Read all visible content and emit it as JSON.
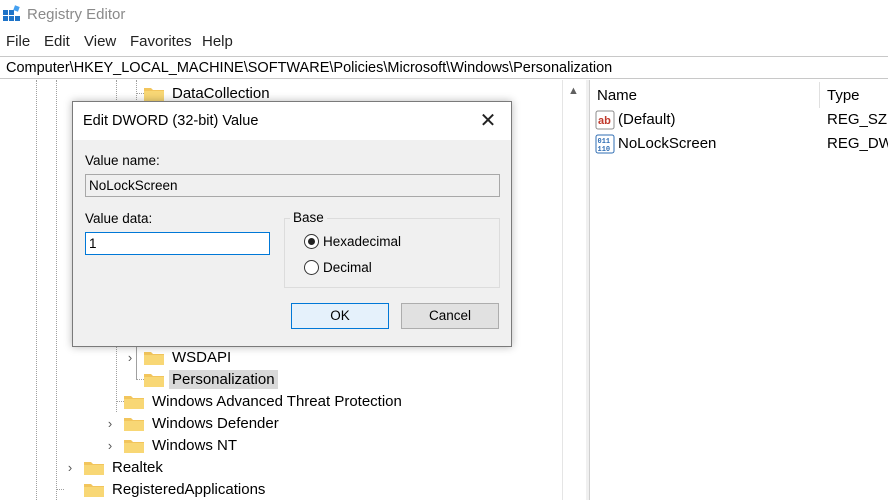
{
  "window": {
    "title": "Registry Editor",
    "icon": "registry-icon"
  },
  "menu": {
    "items": [
      "File",
      "Edit",
      "View",
      "Favorites",
      "Help"
    ]
  },
  "address": "Computer\\HKEY_LOCAL_MACHINE\\SOFTWARE\\Policies\\Microsoft\\Windows\\Personalization",
  "tree": {
    "items": [
      {
        "label": "DataCollection"
      },
      {
        "label": "WSDAPI"
      },
      {
        "label": "Personalization"
      },
      {
        "label": "Windows Advanced Threat Protection"
      },
      {
        "label": "Windows Defender"
      },
      {
        "label": "Windows NT"
      },
      {
        "label": "Realtek"
      },
      {
        "label": "RegisteredApplications"
      }
    ]
  },
  "values_pane": {
    "columns": {
      "name": "Name",
      "type": "Type"
    },
    "rows": [
      {
        "name": "(Default)",
        "type": "REG_SZ",
        "icon": "string-value-icon"
      },
      {
        "name": "NoLockScreen",
        "type": "REG_DWO",
        "icon": "binary-value-icon"
      }
    ]
  },
  "dialog": {
    "title": "Edit DWORD (32-bit) Value",
    "value_name_label": "Value name:",
    "value_name": "NoLockScreen",
    "value_data_label": "Value data:",
    "value_data": "1",
    "base_label": "Base",
    "base_options": [
      "Hexadecimal",
      "Decimal"
    ],
    "base_selected": "Hexadecimal",
    "ok_label": "OK",
    "cancel_label": "Cancel",
    "close_glyph": "✕"
  },
  "colors": {
    "accent": "#0078d7",
    "folder": "#f2c55c",
    "selection": "#d9d9d9",
    "dialog_bg": "#f0f0f0"
  }
}
